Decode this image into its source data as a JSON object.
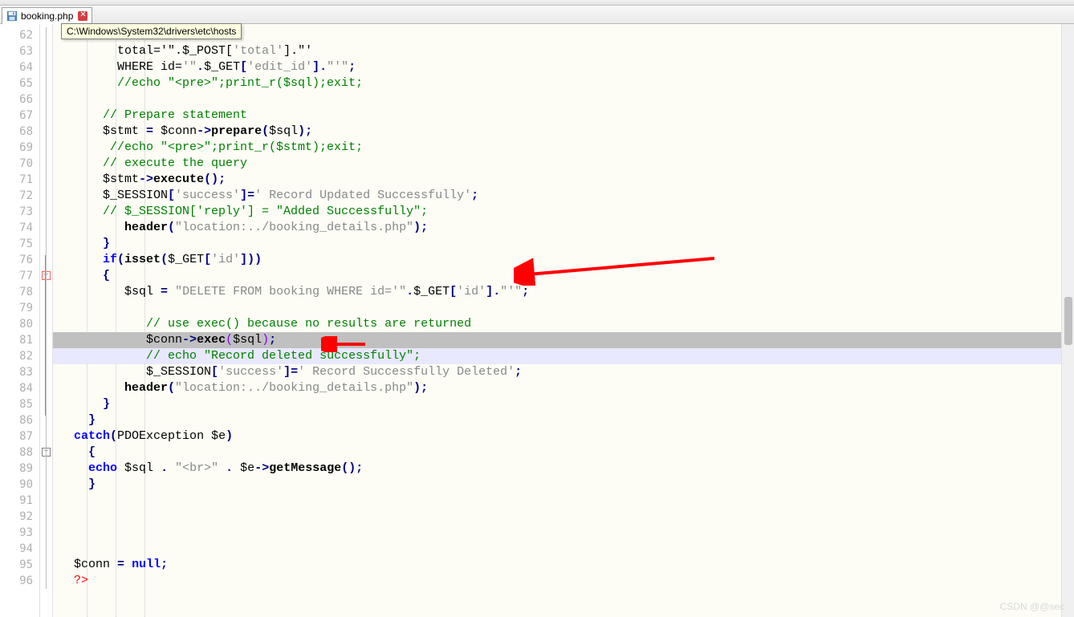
{
  "tab": {
    "filename": "booking.php"
  },
  "tooltip": "C:\\Windows\\System32\\drivers\\etc\\hosts",
  "gutter_start": 62,
  "code_lines": [
    {
      "n": 62,
      "h": ""
    },
    {
      "n": 63,
      "h": "        total='\".<span class='var'>$_POST</span>[<span class='str'>'total'</span>].\"'"
    },
    {
      "n": 64,
      "h": "        WHERE id=<span class='str'>'\"</span><span class='op'>.</span><span class='var'>$_GET</span><span class='op'>[</span><span class='str'>'edit_id'</span><span class='op'>].</span><span class='str'>\"'\"</span><span class='op'>;</span>"
    },
    {
      "n": 65,
      "h": "        <span class='com'>//echo \"&lt;pre&gt;\";print_r($sql);exit;</span>"
    },
    {
      "n": 66,
      "h": ""
    },
    {
      "n": 67,
      "h": "      <span class='com'>// Prepare statement</span>"
    },
    {
      "n": 68,
      "h": "      <span class='var'>$stmt</span> <span class='op'>=</span> <span class='var'>$conn</span><span class='op'>-&gt;</span><span class='fn'>prepare</span><span class='op'>(</span><span class='var'>$sql</span><span class='op'>);</span>"
    },
    {
      "n": 69,
      "h": "       <span class='com'>//echo \"&lt;pre&gt;\";print_r($stmt);exit;</span>"
    },
    {
      "n": 70,
      "h": "      <span class='com'>// execute the query</span>"
    },
    {
      "n": 71,
      "h": "      <span class='var'>$stmt</span><span class='op'>-&gt;</span><span class='fn'>execute</span><span class='op'>();</span>"
    },
    {
      "n": 72,
      "h": "      <span class='var'>$_SESSION</span><span class='op'>[</span><span class='str'>'success'</span><span class='op'>]=</span><span class='str'>' Record Updated Successfully'</span><span class='op'>;</span>"
    },
    {
      "n": 73,
      "h": "      <span class='com'>// $_SESSION['reply'] = \"Added Successfully\";</span>"
    },
    {
      "n": 74,
      "h": "         <span class='fn'>header</span><span class='op'>(</span><span class='str'>\"location:../booking_details.php\"</span><span class='op'>);</span>"
    },
    {
      "n": 75,
      "h": "      <span class='op'>}</span>"
    },
    {
      "n": 76,
      "h": "      <span class='kw'>if</span><span class='op'>(</span><span class='fn'>isset</span><span class='op'>(</span><span class='var'>$_GET</span><span class='op'>[</span><span class='str'>'id'</span><span class='op'>]))</span>"
    },
    {
      "n": 77,
      "h": "      <span class='op'>{</span>"
    },
    {
      "n": 78,
      "h": "         <span class='var'>$sql</span> <span class='op'>=</span> <span class='str'>\"DELETE FROM booking WHERE id='\"</span><span class='op'>.</span><span class='var'>$_GET</span><span class='op'>[</span><span class='str'>'id'</span><span class='op'>].</span><span class='str'>\"'\"</span><span class='op'>;</span>"
    },
    {
      "n": 79,
      "h": ""
    },
    {
      "n": 80,
      "h": "            <span class='com'>// use exec() because no results are returned</span>"
    },
    {
      "n": 81,
      "h": "            <span class='var'>$conn</span><span class='op'>-&gt;</span><span class='fn'>exec</span><span class='arr'>(</span><span class='var'>$sql</span><span class='arr'>)</span><span class='op'>;</span>"
    },
    {
      "n": 82,
      "h": "            <span class='com'>// echo \"Record deleted successfully\";</span>"
    },
    {
      "n": 83,
      "h": "            <span class='var'>$_SESSION</span><span class='op'>[</span><span class='str'>'success'</span><span class='op'>]=</span><span class='str'>' Record Successfully Deleted'</span><span class='op'>;</span>"
    },
    {
      "n": 84,
      "h": "         <span class='fn'>header</span><span class='op'>(</span><span class='str'>\"location:../booking_details.php\"</span><span class='op'>);</span>"
    },
    {
      "n": 85,
      "h": "      <span class='op'>}</span>"
    },
    {
      "n": 86,
      "h": "    <span class='op'>}</span>"
    },
    {
      "n": 87,
      "h": "  <span class='kw'>catch</span><span class='op'>(</span>PDOException <span class='var'>$e</span><span class='op'>)</span>"
    },
    {
      "n": 88,
      "h": "    <span class='op'>{</span>"
    },
    {
      "n": 89,
      "h": "    <span class='kw'>echo</span> <span class='var'>$sql</span> <span class='op'>.</span> <span class='str'>\"&lt;br&gt;\"</span> <span class='op'>.</span> <span class='var'>$e</span><span class='op'>-&gt;</span><span class='fn'>getMessage</span><span class='op'>();</span>"
    },
    {
      "n": 90,
      "h": "    <span class='op'>}</span>"
    },
    {
      "n": 91,
      "h": ""
    },
    {
      "n": 92,
      "h": ""
    },
    {
      "n": 93,
      "h": ""
    },
    {
      "n": 94,
      "h": ""
    },
    {
      "n": 95,
      "h": "  <span class='var'>$conn</span> <span class='op'>=</span> <span class='kw'>null</span><span class='op'>;</span>"
    },
    {
      "n": 96,
      "h": "  <span class='pp'>?&gt;</span>"
    }
  ],
  "watermark": "CSDN @@sec"
}
